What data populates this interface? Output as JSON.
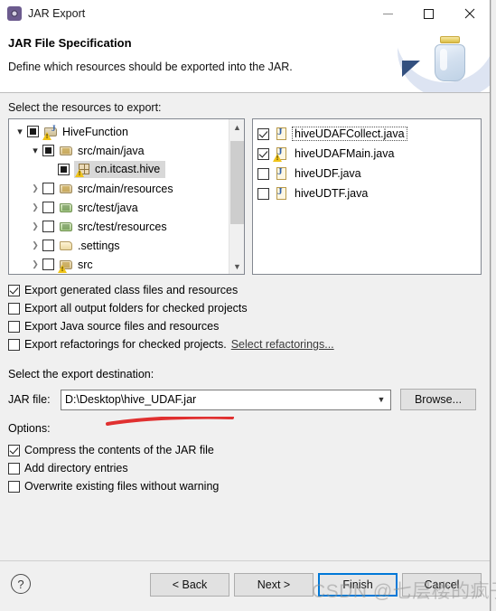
{
  "window": {
    "title": "JAR Export",
    "icon": "eclipse-export-icon",
    "minimize": "—",
    "maximize": "□",
    "close": "✕"
  },
  "banner": {
    "title": "JAR File Specification",
    "subtitle": "Define which resources should be exported into the JAR.",
    "art": "jar-illustration"
  },
  "resources": {
    "label": "Select the resources to export:",
    "tree": [
      {
        "label": "HiveFunction",
        "indent": 0,
        "twisty": "open",
        "check": "partial",
        "icon": "project-icon",
        "warning": true,
        "selected": false
      },
      {
        "label": "src/main/java",
        "indent": 1,
        "twisty": "open",
        "check": "partial",
        "icon": "source-folder-icon",
        "warning": false,
        "selected": false
      },
      {
        "label": "cn.itcast.hive",
        "indent": 2,
        "twisty": "none",
        "check": "partial",
        "icon": "package-icon",
        "warning": true,
        "selected": true
      },
      {
        "label": "src/main/resources",
        "indent": 1,
        "twisty": "closed",
        "check": "none",
        "icon": "source-folder-icon",
        "warning": false,
        "selected": false
      },
      {
        "label": "src/test/java",
        "indent": 1,
        "twisty": "closed",
        "check": "none",
        "icon": "source-folder-green-icon",
        "warning": false,
        "selected": false
      },
      {
        "label": "src/test/resources",
        "indent": 1,
        "twisty": "closed",
        "check": "none",
        "icon": "source-folder-green-icon",
        "warning": false,
        "selected": false
      },
      {
        "label": ".settings",
        "indent": 1,
        "twisty": "closed",
        "check": "none",
        "icon": "folder-icon",
        "warning": false,
        "selected": false
      },
      {
        "label": "src",
        "indent": 1,
        "twisty": "closed",
        "check": "none",
        "icon": "source-folder-icon",
        "warning": true,
        "selected": false
      }
    ],
    "files": [
      {
        "label": "hiveUDAFCollect.java",
        "check": "checked",
        "icon": "java-file-icon",
        "warning": false,
        "focused": true
      },
      {
        "label": "hiveUDAFMain.java",
        "check": "checked",
        "icon": "java-file-icon",
        "warning": true,
        "focused": false
      },
      {
        "label": "hiveUDF.java",
        "check": "none",
        "icon": "java-file-icon",
        "warning": false,
        "focused": false
      },
      {
        "label": "hiveUDTF.java",
        "check": "none",
        "icon": "java-file-icon",
        "warning": false,
        "focused": false
      }
    ]
  },
  "export_options": [
    {
      "label": "Export generated class files and resources",
      "check": "checked"
    },
    {
      "label": "Export all output folders for checked projects",
      "check": "none"
    },
    {
      "label": "Export Java source files and resources",
      "check": "none"
    },
    {
      "label": "Export refactorings for checked projects.",
      "check": "none",
      "link": "Select refactorings..."
    }
  ],
  "destination": {
    "label": "Select the export destination:",
    "jar_file_label": "JAR file:",
    "jar_file_value": "D:\\Desktop\\hive_UDAF.jar",
    "jar_file_placeholder": "",
    "browse_label": "Browse...",
    "annotation_color": "#e03030"
  },
  "options": {
    "label": "Options:",
    "items": [
      {
        "label": "Compress the contents of the JAR file",
        "check": "checked"
      },
      {
        "label": "Add directory entries",
        "check": "none"
      },
      {
        "label": "Overwrite existing files without warning",
        "check": "none"
      }
    ]
  },
  "footer": {
    "help": "?",
    "back": "< Back",
    "next": "Next >",
    "finish": "Finish",
    "cancel": "Cancel"
  },
  "watermark": {
    "text": "CSDN @七层楼的疯子"
  }
}
